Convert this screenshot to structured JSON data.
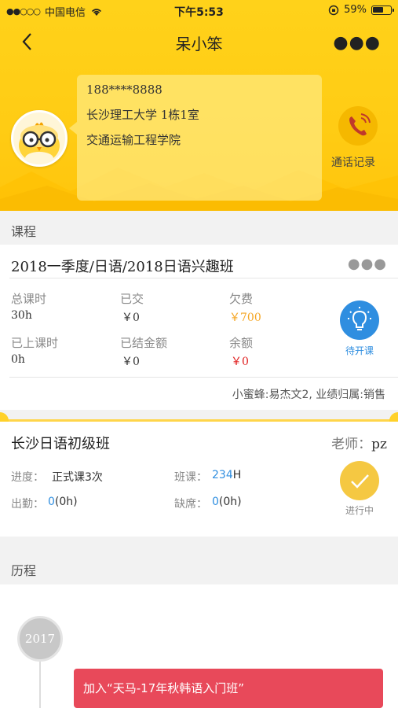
{
  "status_bar": {
    "carrier": "中国电信",
    "time": "下午5:53",
    "battery": "59%"
  },
  "nav": {
    "title": "呆小笨"
  },
  "profile": {
    "phone": "188****8888",
    "address": "长沙理工大学 1栋1室",
    "college": "交通运输工程学院",
    "call_log_label": "通话记录"
  },
  "course_section": {
    "title": "课程"
  },
  "course": {
    "name": "2018一季度/日语/2018日语兴趣班",
    "stats": [
      {
        "label": "总课时",
        "value": "30h"
      },
      {
        "label": "已交",
        "value": "￥0"
      },
      {
        "label": "欠费",
        "value": "￥700"
      },
      {
        "label": "已上课时",
        "value": "0h"
      },
      {
        "label": "已结金额",
        "value": "￥0"
      },
      {
        "label": "余额",
        "value": "￥0"
      }
    ],
    "status": "待开课",
    "seller": "小蜜蜂:易杰文2, 业绩归属:销售",
    "colors": {
      "arrears": "#f5a623",
      "balance": "#e02020",
      "status_blue": "#2f8ee0"
    }
  },
  "class": {
    "name": "长沙日语初级班",
    "teacher_label": "老师：",
    "teacher": "pz",
    "progress_label": "进度：",
    "progress": "正式课3次",
    "lessons_label": "班课：",
    "lessons_value": "234",
    "lessons_unit": "H",
    "attendance_label": "出勤：",
    "attendance_count": "0",
    "attendance_hours": "(0h)",
    "absence_label": "缺席：",
    "absence_count": "0",
    "absence_hours": "(0h)",
    "status": "进行中",
    "status_color": "#f5c842"
  },
  "history_section": {
    "title": "历程"
  },
  "history": {
    "year": "2017",
    "event": "加入“天马-17年秋韩语入门班”"
  }
}
